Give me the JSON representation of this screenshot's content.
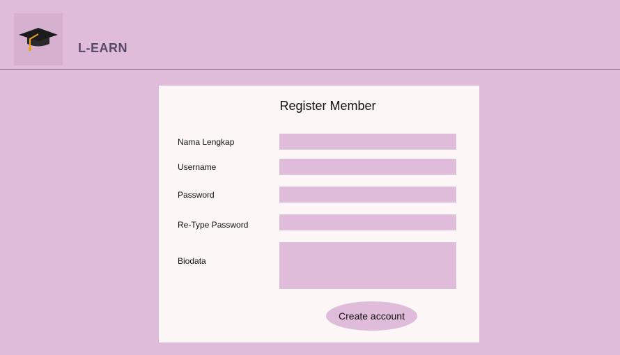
{
  "header": {
    "brand": "L-EARN",
    "logo_icon": "graduation-cap-icon"
  },
  "form": {
    "title": "Register Member",
    "fields": [
      {
        "label": "Nama Lengkap",
        "value": ""
      },
      {
        "label": "Username",
        "value": ""
      },
      {
        "label": "Password",
        "value": ""
      },
      {
        "label": "Re-Type Password",
        "value": ""
      },
      {
        "label": "Biodata",
        "value": ""
      }
    ],
    "submit_label": "Create account"
  },
  "colors": {
    "background": "#dfbcd9",
    "card": "#fdf6f6",
    "brand_text": "#5a4a6a"
  }
}
